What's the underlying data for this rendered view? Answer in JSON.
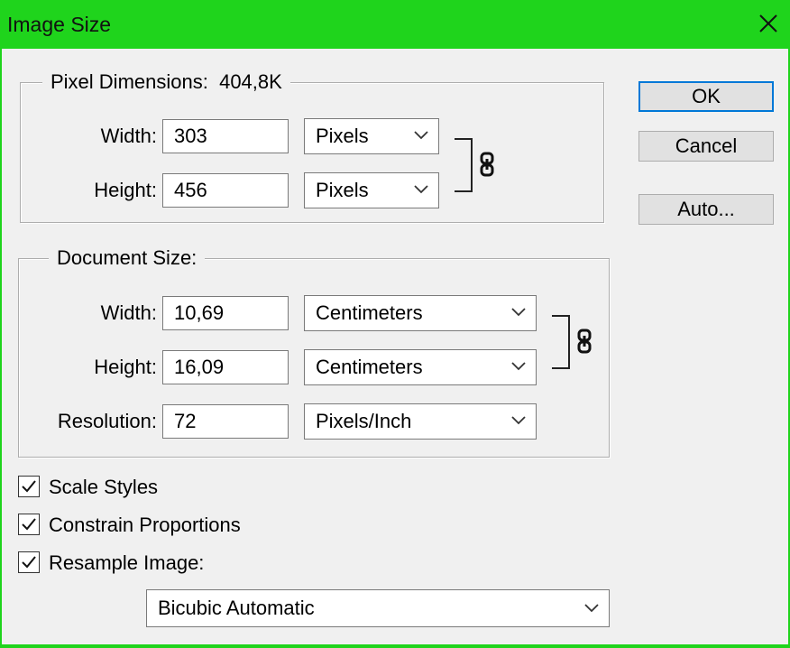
{
  "window": {
    "title": "Image Size"
  },
  "pixel_dimensions": {
    "legend": "Pixel Dimensions:",
    "size_value": "404,8K",
    "width_label": "Width:",
    "width_value": "303",
    "width_unit": "Pixels",
    "height_label": "Height:",
    "height_value": "456",
    "height_unit": "Pixels"
  },
  "document_size": {
    "legend": "Document Size:",
    "width_label": "Width:",
    "width_value": "10,69",
    "width_unit": "Centimeters",
    "height_label": "Height:",
    "height_value": "16,09",
    "height_unit": "Centimeters",
    "resolution_label": "Resolution:",
    "resolution_value": "72",
    "resolution_unit": "Pixels/Inch"
  },
  "options": {
    "scale_styles_label": "Scale Styles",
    "scale_styles_checked": true,
    "constrain_label": "Constrain Proportions",
    "constrain_checked": true,
    "resample_label": "Resample Image:",
    "resample_checked": true,
    "resample_method": "Bicubic Automatic"
  },
  "buttons": {
    "ok": "OK",
    "cancel": "Cancel",
    "auto": "Auto..."
  },
  "icons": {
    "close": "close-icon",
    "link": "chain-link-icon",
    "dropdown": "chevron-down-icon",
    "check": "checkmark-icon"
  },
  "colors": {
    "title_bar": "#1fd41c",
    "dialog_bg": "#f0f0f0",
    "default_button_border": "#0078d7"
  }
}
